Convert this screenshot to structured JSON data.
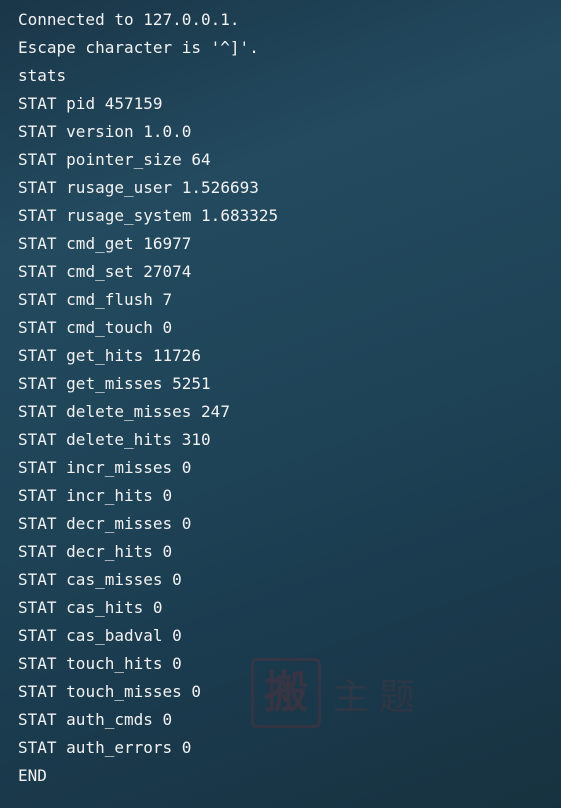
{
  "header": {
    "connected": "Connected to 127.0.0.1.",
    "escape": "Escape character is '^]'.",
    "command": "stats"
  },
  "stats": [
    {
      "key": "pid",
      "value": "457159"
    },
    {
      "key": "version",
      "value": "1.0.0"
    },
    {
      "key": "pointer_size",
      "value": "64"
    },
    {
      "key": "rusage_user",
      "value": "1.526693"
    },
    {
      "key": "rusage_system",
      "value": "1.683325"
    },
    {
      "key": "cmd_get",
      "value": "16977"
    },
    {
      "key": "cmd_set",
      "value": "27074"
    },
    {
      "key": "cmd_flush",
      "value": "7"
    },
    {
      "key": "cmd_touch",
      "value": "0"
    },
    {
      "key": "get_hits",
      "value": "11726"
    },
    {
      "key": "get_misses",
      "value": "5251"
    },
    {
      "key": "delete_misses",
      "value": "247"
    },
    {
      "key": "delete_hits",
      "value": "310"
    },
    {
      "key": "incr_misses",
      "value": "0"
    },
    {
      "key": "incr_hits",
      "value": "0"
    },
    {
      "key": "decr_misses",
      "value": "0"
    },
    {
      "key": "decr_hits",
      "value": "0"
    },
    {
      "key": "cas_misses",
      "value": "0"
    },
    {
      "key": "cas_hits",
      "value": "0"
    },
    {
      "key": "cas_badval",
      "value": "0"
    },
    {
      "key": "touch_hits",
      "value": "0"
    },
    {
      "key": "touch_misses",
      "value": "0"
    },
    {
      "key": "auth_cmds",
      "value": "0"
    },
    {
      "key": "auth_errors",
      "value": "0"
    }
  ],
  "footer": {
    "end": "END"
  },
  "watermark": {
    "seal": "搬",
    "text": "主题"
  }
}
